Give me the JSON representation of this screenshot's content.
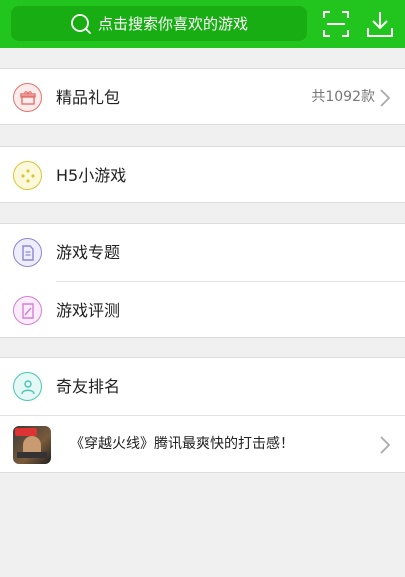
{
  "search": {
    "placeholder": "点击搜索你喜欢的游戏"
  },
  "icons": {
    "search": "search-icon",
    "scan": "scan-icon",
    "download": "download-icon"
  },
  "menu": {
    "gift": {
      "label": "精品礼包",
      "count": "共1092款"
    },
    "h5": {
      "label": "H5小游戏"
    },
    "topics": {
      "label": "游戏专题"
    },
    "reviews": {
      "label": "游戏评测"
    },
    "ranking": {
      "label": "奇友排名"
    },
    "promo": {
      "text": "《穿越火线》腾讯最爽快的打击感！"
    }
  },
  "colors": {
    "brand": "#21c51e",
    "gift": "#e4736e",
    "h5": "#d9c635",
    "topics": "#8b86d6",
    "reviews": "#d47fd6",
    "ranking": "#47c7b6"
  }
}
